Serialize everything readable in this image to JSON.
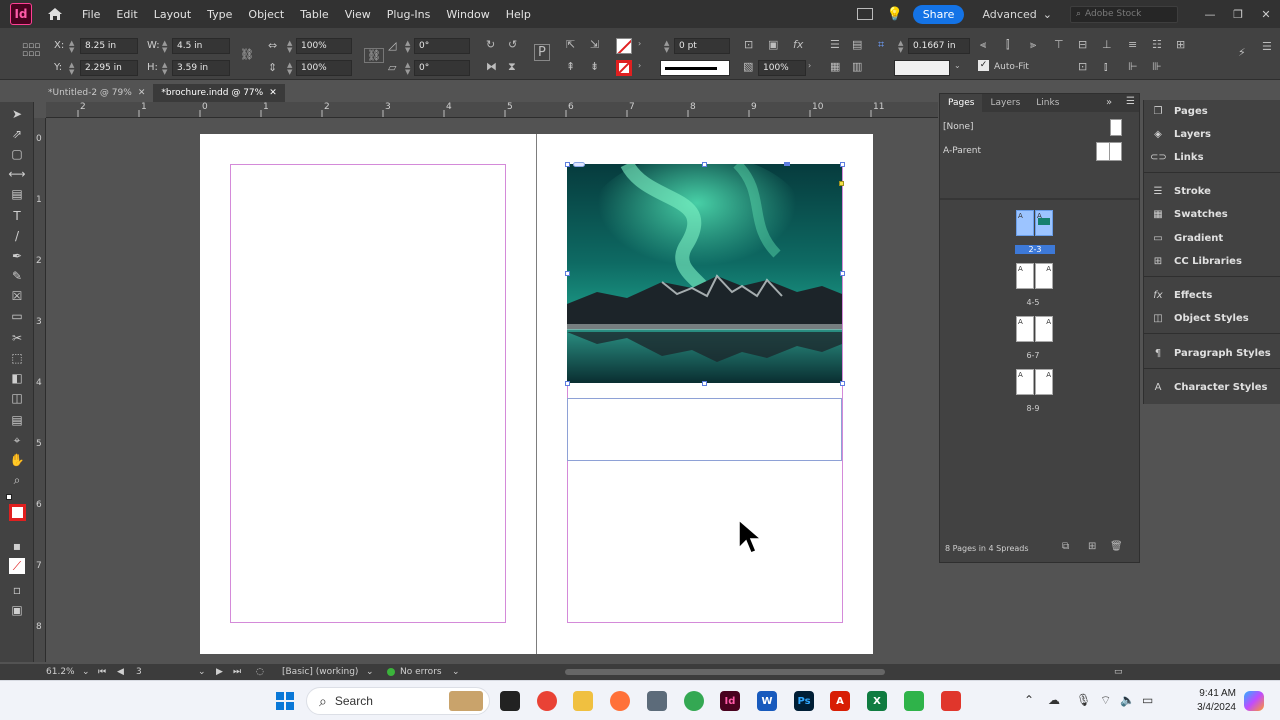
{
  "app": {
    "logo_text": "Id"
  },
  "menu": [
    "File",
    "Edit",
    "Layout",
    "Type",
    "Object",
    "Table",
    "View",
    "Plug-Ins",
    "Window",
    "Help"
  ],
  "menu_right": {
    "share_label": "Share",
    "workspace": "Advanced",
    "stock_placeholder": "Adobe Stock"
  },
  "control": {
    "x_label": "X:",
    "x_value": "8.25 in",
    "y_label": "Y:",
    "y_value": "2.295 in",
    "w_label": "W:",
    "w_value": "4.5 in",
    "h_label": "H:",
    "h_value": "3.59 in",
    "scale_x": "100%",
    "scale_y": "100%",
    "rotate": "0°",
    "shear": "0°",
    "stroke_weight": "0 pt",
    "opacity": "100%",
    "offset": "0.1667 in",
    "autofit_label": "Auto-Fit"
  },
  "tabs": [
    {
      "label": "*Untitled-2 @ 79%",
      "active": false
    },
    {
      "label": "*brochure.indd @ 77%",
      "active": true
    }
  ],
  "ruler_h": [
    "2",
    "1",
    "0",
    "1",
    "2",
    "3",
    "4",
    "5",
    "6",
    "7",
    "8",
    "9",
    "10",
    "11"
  ],
  "ruler_v": [
    "0",
    "1",
    "2",
    "3",
    "4",
    "5",
    "6",
    "7",
    "8"
  ],
  "pages_panel": {
    "tabs": [
      "Pages",
      "Layers",
      "Links"
    ],
    "none_label": "[None]",
    "parent_label": "A-Parent",
    "spreads": [
      "2-3",
      "4-5",
      "6-7",
      "8-9"
    ],
    "thumb_letter": "A",
    "footer": "8 Pages in 4 Spreads"
  },
  "dock": [
    {
      "label": "Pages",
      "icon": "pages-icon"
    },
    {
      "label": "Layers",
      "icon": "layers-icon"
    },
    {
      "label": "Links",
      "icon": "links-icon"
    },
    {
      "label": "Stroke",
      "icon": "stroke-icon"
    },
    {
      "label": "Swatches",
      "icon": "swatches-icon"
    },
    {
      "label": "Gradient",
      "icon": "gradient-icon"
    },
    {
      "label": "CC Libraries",
      "icon": "cc-libraries-icon"
    },
    {
      "label": "Effects",
      "icon": "effects-icon"
    },
    {
      "label": "Object Styles",
      "icon": "object-styles-icon"
    },
    {
      "label": "Paragraph Styles",
      "icon": "paragraph-styles-icon"
    },
    {
      "label": "Character Styles",
      "icon": "character-styles-icon"
    }
  ],
  "status": {
    "zoom": "61.2%",
    "page": "3",
    "preflight_profile": "[Basic] (working)",
    "errors": "No errors"
  },
  "taskbar": {
    "search_label": "Search",
    "time": "9:41 AM",
    "date": "3/4/2024",
    "apps": [
      {
        "name": "file-explorer",
        "label": "",
        "color": "#f0c040"
      },
      {
        "name": "chrome",
        "label": "",
        "color": "#e94235"
      },
      {
        "name": "firefox",
        "label": "",
        "color": "#ff7139"
      },
      {
        "name": "indesign",
        "label": "Id",
        "color": "#49021f"
      },
      {
        "name": "word",
        "label": "W",
        "color": "#185abd"
      },
      {
        "name": "photoshop",
        "label": "Ps",
        "color": "#001e36"
      },
      {
        "name": "acrobat",
        "label": "A",
        "color": "#d81e05"
      },
      {
        "name": "excel",
        "label": "X",
        "color": "#107c41"
      }
    ]
  }
}
